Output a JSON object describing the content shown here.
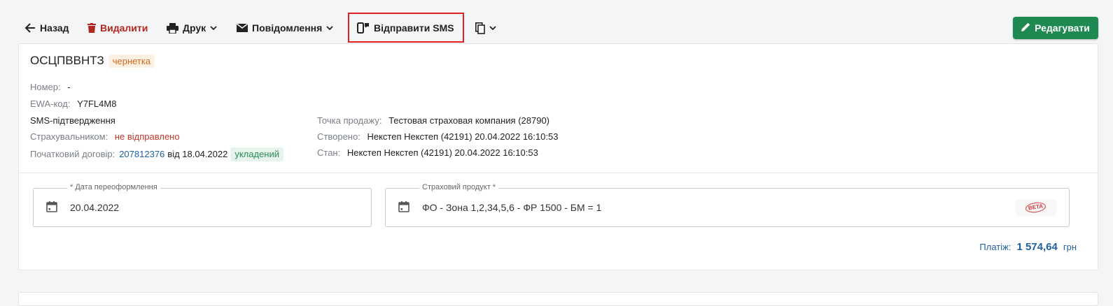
{
  "toolbar": {
    "back_label": "Назад",
    "delete_label": "Видалити",
    "print_label": "Друк",
    "messages_label": "Повідомлення",
    "send_sms_label": "Відправити SMS",
    "edit_label": "Редагувати",
    "icons": [
      "arrow-left-icon",
      "trash-icon",
      "printer-icon",
      "envelope-icon",
      "phone-sms-icon",
      "copy-icon",
      "pencil-icon",
      "chevron-down-icon"
    ]
  },
  "document": {
    "title": "ОСЦПВВНТЗ",
    "status_badge": "чернетка",
    "number_label": "Номер:",
    "number_value": "-",
    "ewa_label": "EWA-код:",
    "ewa_value": "Y7FL4M8",
    "sms_heading": "SMS-підтвердження",
    "insurer_label": "Страхувальником:",
    "insurer_value": "не відправлено",
    "initial_contract_label": "Початковий договір:",
    "initial_contract_number": "207812376",
    "initial_contract_date": "від 18.04.2022",
    "initial_contract_status": "укладений",
    "point_of_sale_label": "Точка продажу:",
    "point_of_sale_value": "Тестовая страховая компания (28790)",
    "created_label": "Створено:",
    "created_value": "Некстеп Некстеп (42191) 20.04.2022 16:10:53",
    "state_label": "Стан:",
    "state_value": "Некстеп Некстеп (42191) 20.04.2022 16:10:53"
  },
  "fields": {
    "reissue_date_label": "* Дата переоформлення",
    "reissue_date_value": "20.04.2022",
    "product_label": "Страховий продукт *",
    "product_value": "ФО - Зона 1,2,34,5,6 - ФР 1500 - БМ = 1",
    "beta_text": "BETA"
  },
  "payment": {
    "label": "Платіж:",
    "amount": "1 574,64",
    "currency": "грн"
  },
  "colors": {
    "accent_green": "#1e8a52",
    "delete_red": "#b3261e",
    "link_blue": "#1f5f9e",
    "highlight_red": "#e02020"
  }
}
